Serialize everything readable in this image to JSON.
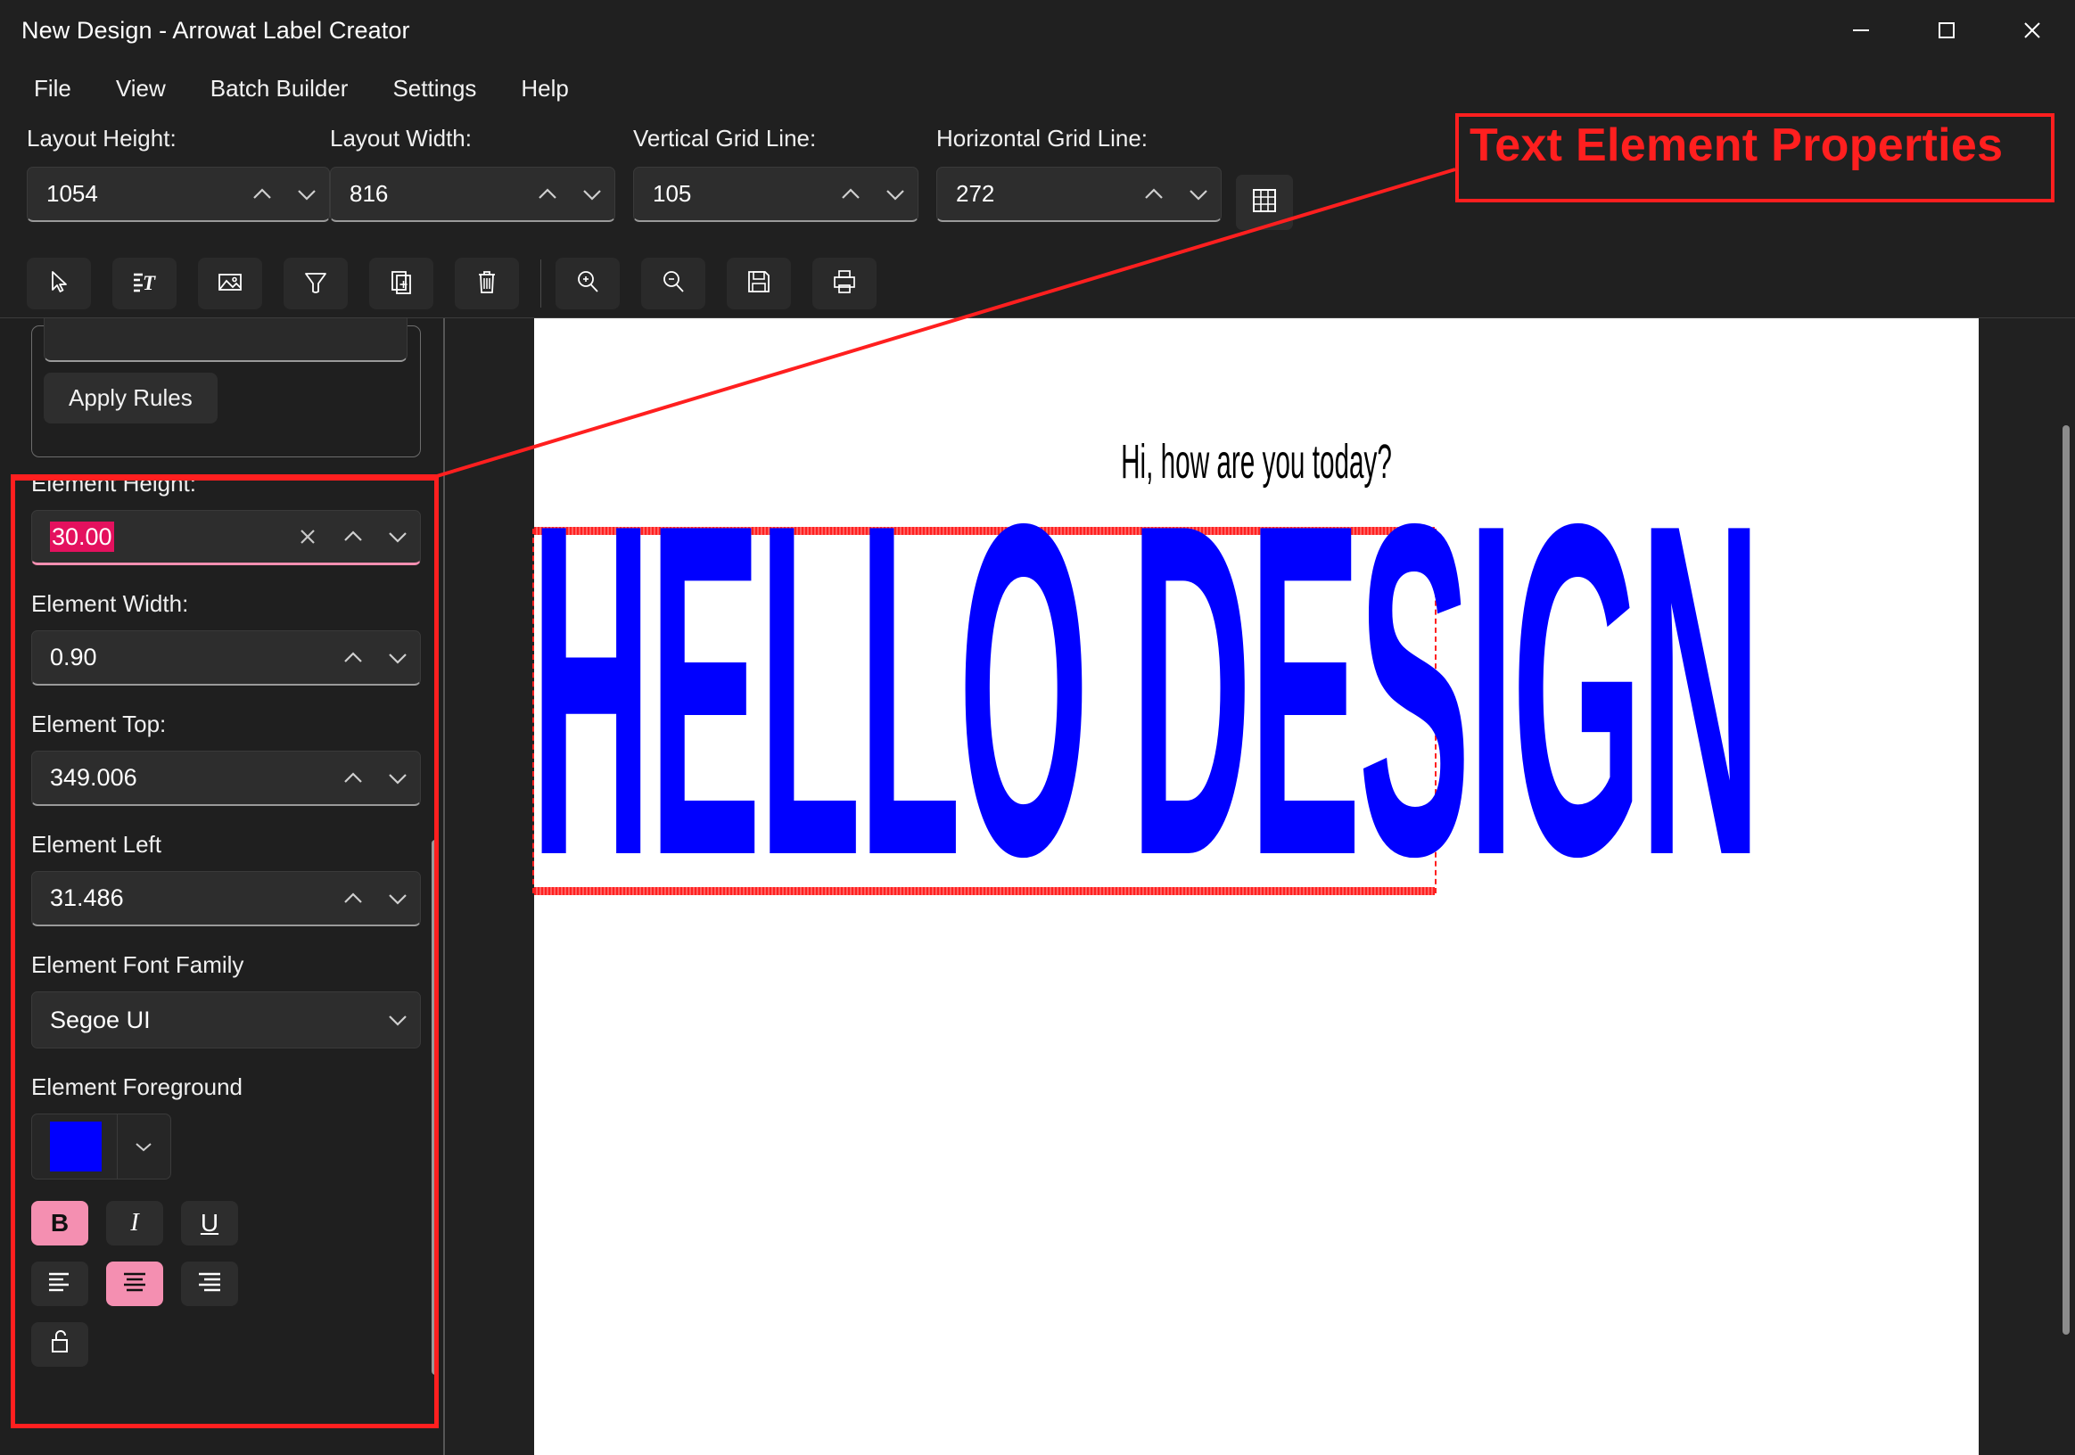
{
  "window": {
    "title": "New Design - Arrowat Label Creator",
    "minimize_label": "Minimize",
    "maximize_label": "Maximize",
    "close_label": "Close"
  },
  "menubar": {
    "items": [
      {
        "label": "File"
      },
      {
        "label": "View"
      },
      {
        "label": "Batch Builder"
      },
      {
        "label": "Settings"
      },
      {
        "label": "Help"
      }
    ]
  },
  "layout_properties": [
    {
      "label": "Layout Height:",
      "value": "1054"
    },
    {
      "label": "Layout Width:",
      "value": "816"
    },
    {
      "label": "Vertical Grid Line:",
      "value": "105"
    },
    {
      "label": "Horizontal Grid Line:",
      "value": "272"
    }
  ],
  "grid_toggle": {
    "icon": "grid-icon"
  },
  "toolbar": {
    "buttons": [
      {
        "icon": "cursor-select-icon",
        "name": "select-tool"
      },
      {
        "icon": "add-text-icon",
        "name": "add-text-tool"
      },
      {
        "icon": "add-image-icon",
        "name": "add-image-tool"
      },
      {
        "icon": "funnel-icon",
        "name": "filter-tool"
      },
      {
        "icon": "duplicate-page-icon",
        "name": "duplicate-tool"
      },
      {
        "icon": "trash-icon",
        "name": "delete-tool"
      },
      {
        "icon": "zoom-in-icon",
        "name": "zoom-in-tool"
      },
      {
        "icon": "zoom-out-icon",
        "name": "zoom-out-tool"
      },
      {
        "icon": "save-icon",
        "name": "save-tool"
      },
      {
        "icon": "print-icon",
        "name": "print-tool"
      }
    ]
  },
  "sidebar": {
    "rules": {
      "apply_label": "Apply Rules",
      "input_value": ""
    },
    "element_height": {
      "label": "Element Height:",
      "value": "30.00",
      "selected": true
    },
    "element_width": {
      "label": "Element Width:",
      "value": "0.90"
    },
    "element_top": {
      "label": "Element Top:",
      "value": "349.006"
    },
    "element_left": {
      "label": "Element Left",
      "value": "31.486"
    },
    "font_family": {
      "label": "Element Font Family",
      "value": "Segoe UI"
    },
    "foreground": {
      "label": "Element Foreground",
      "color": "#0000ff"
    },
    "style_buttons": [
      {
        "label": "B",
        "name": "bold-button",
        "active": true
      },
      {
        "label": "I",
        "name": "italic-button",
        "active": false
      },
      {
        "label": "U",
        "name": "underline-button",
        "active": false
      }
    ],
    "align_buttons": [
      {
        "name": "align-left-button",
        "active": false
      },
      {
        "name": "align-center-button",
        "active": true
      },
      {
        "name": "align-right-button",
        "active": false
      }
    ],
    "lock_button": {
      "name": "unlock-button",
      "icon": "unlocked-padlock-icon"
    }
  },
  "canvas": {
    "static_text": "Hi, how are you today?",
    "selected_text": "HELLO DESIGN",
    "selected_color": "#0000ff",
    "selection_border_color": "#ff2020"
  },
  "annotation": {
    "label": "Text Element Properties",
    "color": "#ff1f1f"
  }
}
